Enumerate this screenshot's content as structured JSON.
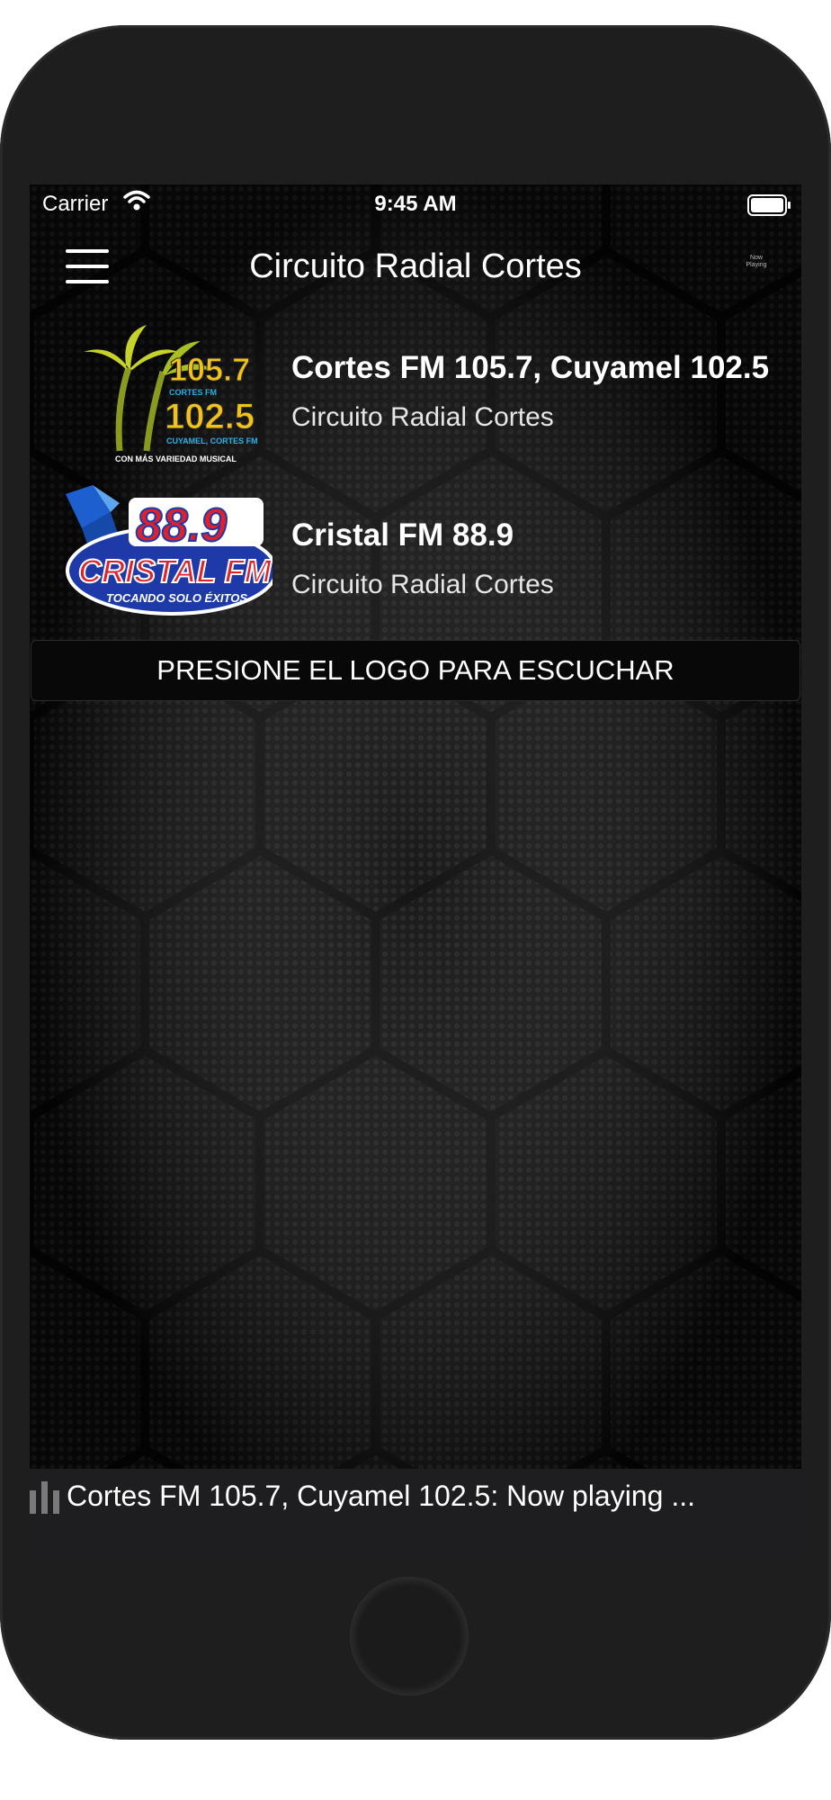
{
  "status_bar": {
    "carrier": "Carrier",
    "time": "9:45 AM"
  },
  "nav": {
    "title": "Circuito Radial Cortes",
    "now_playing_line1": "Now",
    "now_playing_line2": "Playing"
  },
  "stations": [
    {
      "name": "Cortes FM 105.7, Cuyamel 102.5",
      "subtitle": "Circuito Radial Cortes",
      "logo": {
        "line1": "105.7",
        "line2": "CORTES FM",
        "line3": "102.5",
        "line4": "CUYAMEL, CORTES FM",
        "tagline": "CON MÁS VARIEDAD MUSICAL"
      }
    },
    {
      "name": "Cristal FM 88.9",
      "subtitle": "Circuito Radial Cortes",
      "logo": {
        "freq": "88.9",
        "brand": "CRISTAL FM",
        "tagline": "TOCANDO SOLO ÉXITOS"
      }
    }
  ],
  "banner": {
    "text": "PRESIONE EL LOGO PARA ESCUCHAR"
  },
  "player": {
    "text": "Cortes FM 105.7, Cuyamel 102.5: Now playing ..."
  },
  "colors": {
    "phone_body": "#1e1e1e",
    "screen_bg": "#0a0a0a",
    "player_bg": "#1e1e21",
    "logo_yellow": "#f2c21a",
    "logo_blue": "#1e3aa8",
    "logo_red": "#e0202a"
  }
}
